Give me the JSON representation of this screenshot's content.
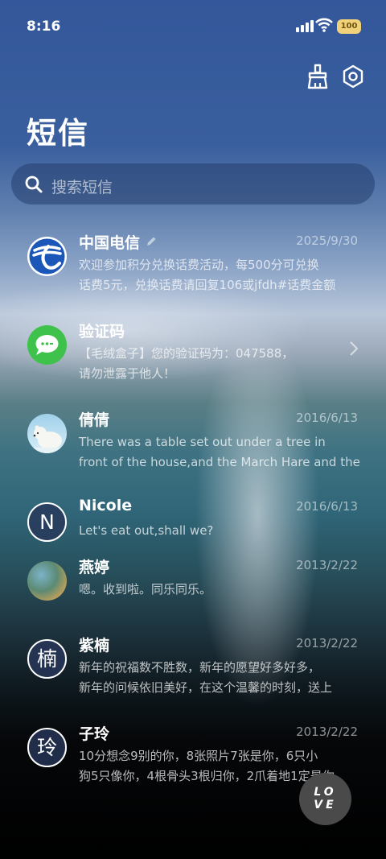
{
  "status_bar": {
    "time": "8:16",
    "battery": "100"
  },
  "header": {
    "title": "短信"
  },
  "search": {
    "placeholder": "搜索短信"
  },
  "conversations": [
    {
      "name": "中国电信",
      "date": "2025/9/30",
      "lines": [
        "欢迎参加积分兑换话费活动，每500分可兑换",
        "话费5元，兑换话费请回复106或jfdh#话费金额"
      ]
    },
    {
      "name": "验证码",
      "date": "",
      "lines": [
        "【毛绒盒子】您的验证码为：047588，",
        "请勿泄露于他人！"
      ]
    },
    {
      "name": "倩倩",
      "date": "2016/6/13",
      "lines": [
        "There was a table set out under a tree in",
        "front of the house,and the March Hare and the"
      ]
    },
    {
      "name": "Nicole",
      "date": "2016/6/13",
      "avatar_letter": "N",
      "lines": [
        "Let's eat out,shall we?"
      ]
    },
    {
      "name": "燕婷",
      "date": "2013/2/22",
      "lines": [
        "嗯。收到啦。同乐同乐。"
      ]
    },
    {
      "name": "紫楠",
      "date": "2013/2/22",
      "avatar_letter": "楠",
      "lines": [
        "新年的祝福数不胜数，新年的愿望好多好多，",
        "新年的问候依旧美好，在这个温馨的时刻，送上"
      ]
    },
    {
      "name": "子玲",
      "date": "2013/2/22",
      "avatar_letter": "玲",
      "lines": [
        "10分想念9别的你，8张照片7张是你，6只小",
        "狗5只像你，4根骨头3根归你，2爪着地1定是你"
      ]
    }
  ],
  "fab": {
    "line1": "LO",
    "line2": "VE"
  },
  "icons": [
    "cleaner-broom-icon",
    "settings-hexagon-icon",
    "search-icon",
    "edit-pencil-icon",
    "chevron-right-icon"
  ]
}
